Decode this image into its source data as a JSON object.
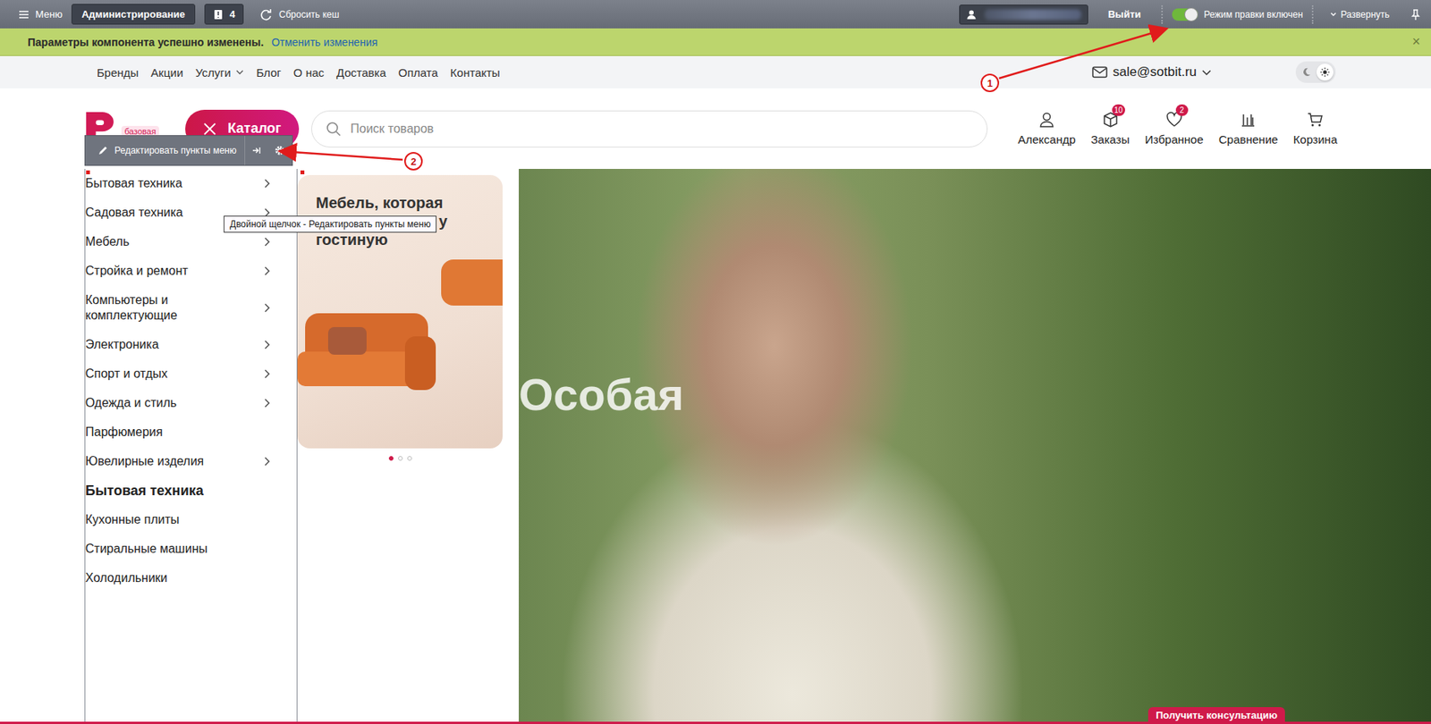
{
  "admin_bar": {
    "menu": "Меню",
    "admin_button": "Администрирование",
    "notifications_count": "4",
    "reset_cache": "Сбросить кеш",
    "logout": "Выйти",
    "edit_mode": {
      "label": "Режим правки включен",
      "on": true
    },
    "expand": "Развернуть"
  },
  "notice": {
    "message": "Параметры компонента успешно изменены.",
    "undo": "Отменить изменения",
    "close": "×"
  },
  "top_nav": {
    "links": [
      {
        "label": "Бренды",
        "has_dropdown": false
      },
      {
        "label": "Акции",
        "has_dropdown": false
      },
      {
        "label": "Услуги",
        "has_dropdown": true
      },
      {
        "label": "Блог",
        "has_dropdown": false
      },
      {
        "label": "О нас",
        "has_dropdown": false
      },
      {
        "label": "Доставка",
        "has_dropdown": false
      },
      {
        "label": "Оплата",
        "has_dropdown": false
      },
      {
        "label": "Контакты",
        "has_dropdown": false
      }
    ],
    "email": "sale@sotbit.ru",
    "theme": {
      "light_selected": true
    }
  },
  "header": {
    "logo_badge": "базовая",
    "catalog_button": {
      "label": "Каталог",
      "open": true
    },
    "search": {
      "placeholder": "Поиск товаров"
    },
    "actions": [
      {
        "label": "Александр",
        "kind": "user",
        "badge": ""
      },
      {
        "label": "Заказы",
        "kind": "box",
        "badge": "10"
      },
      {
        "label": "Избранное",
        "kind": "heart",
        "badge": "2"
      },
      {
        "label": "Сравнение",
        "kind": "compare",
        "badge": ""
      },
      {
        "label": "Корзина",
        "kind": "cart",
        "badge": ""
      }
    ]
  },
  "edit_toolbar": {
    "label": "Редактировать пункты меню"
  },
  "tooltip": "Двойной щелчок - Редактировать пункты меню",
  "catalog_menu": {
    "items": [
      {
        "label": "Бытовая техника",
        "has_children": true
      },
      {
        "label": "Садовая техника",
        "has_children": true
      },
      {
        "label": "Мебель",
        "has_children": true
      },
      {
        "label": "Стройка и ремонт",
        "has_children": true
      },
      {
        "label": "Компьютеры и комплектующие",
        "has_children": true
      },
      {
        "label": "Электроника",
        "has_children": true
      },
      {
        "label": "Спорт и отдых",
        "has_children": true
      },
      {
        "label": "Одежда и стиль",
        "has_children": true
      },
      {
        "label": "Парфюмерия",
        "has_children": false
      },
      {
        "label": "Ювелирные изделия",
        "has_children": true
      }
    ],
    "submenu": {
      "title": "Бытовая техника",
      "items": [
        "Кухонные плиты",
        "Стиральные машины",
        "Холодильники"
      ]
    }
  },
  "promo_card": {
    "lines": [
      "Мебель, которая",
      "у",
      "гостиную"
    ],
    "dots": [
      {
        "selected": true
      },
      {
        "selected": false
      },
      {
        "selected": false
      }
    ]
  },
  "hero": {
    "title": "Особая"
  },
  "consult_button": "Получить консультацию",
  "annotations": [
    {
      "number": "1"
    },
    {
      "number": "2"
    }
  ]
}
